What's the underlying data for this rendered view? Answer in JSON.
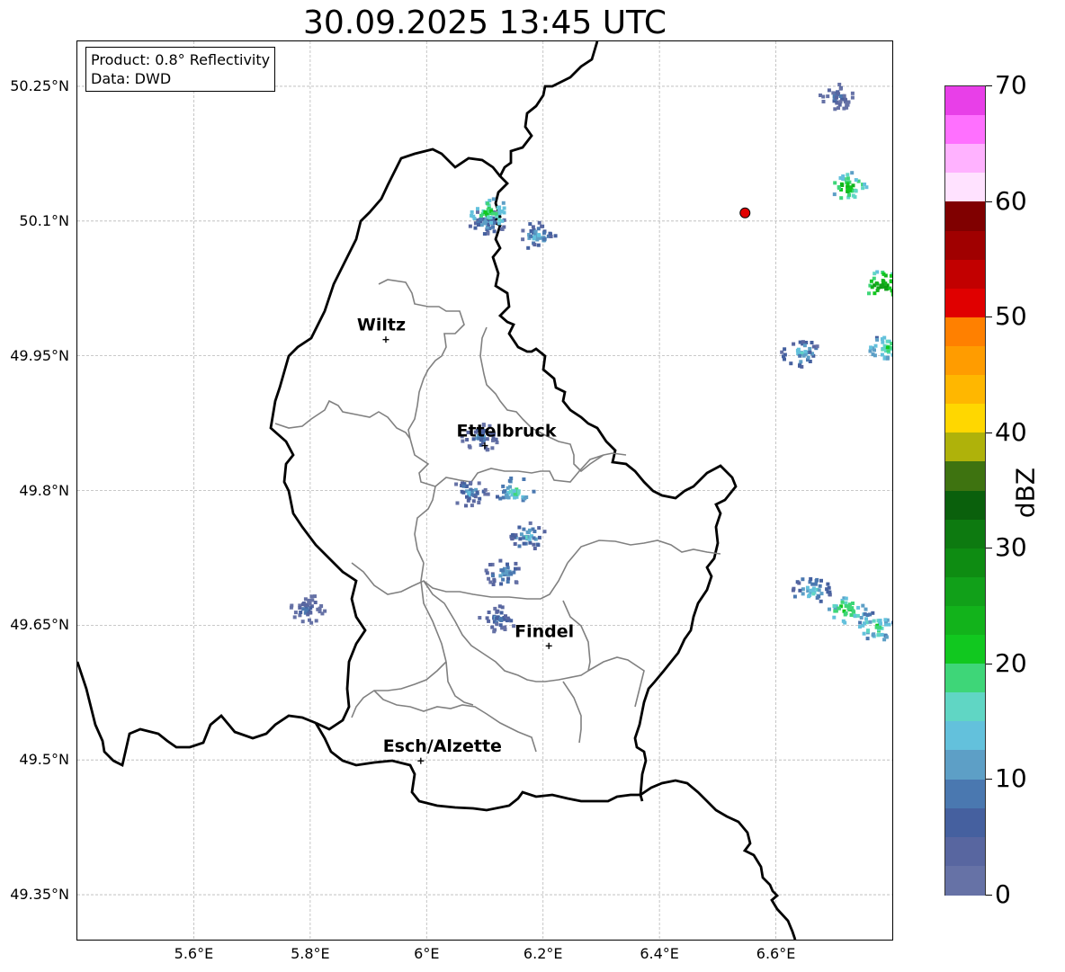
{
  "title": "30.09.2025 13:45 UTC",
  "info": {
    "product": "Product: 0.8° Reflectivity",
    "data": "Data: DWD"
  },
  "y_ticks": [
    {
      "value": 50.25,
      "label": "50.25°N"
    },
    {
      "value": 50.1,
      "label": "50.1°N"
    },
    {
      "value": 49.95,
      "label": "49.95°N"
    },
    {
      "value": 49.8,
      "label": "49.8°N"
    },
    {
      "value": 49.65,
      "label": "49.65°N"
    },
    {
      "value": 49.5,
      "label": "49.5°N"
    },
    {
      "value": 49.35,
      "label": "49.35°N"
    }
  ],
  "x_ticks": [
    {
      "value": 5.6,
      "label": "5.6°E"
    },
    {
      "value": 5.8,
      "label": "5.8°E"
    },
    {
      "value": 6.0,
      "label": "6°E"
    },
    {
      "value": 6.2,
      "label": "6.2°E"
    },
    {
      "value": 6.4,
      "label": "6.4°E"
    },
    {
      "value": 6.6,
      "label": "6.6°E"
    }
  ],
  "extent": {
    "lon": [
      5.4,
      6.8
    ],
    "lat": [
      49.3,
      50.3
    ]
  },
  "cities": [
    {
      "name": "Wiltz",
      "lon": 5.93,
      "lat": 49.968
    },
    {
      "name": "Ettelbruck",
      "lon": 6.1,
      "lat": 49.85
    },
    {
      "name": "Findel",
      "lon": 6.21,
      "lat": 49.627
    },
    {
      "name": "Esch/Alzette",
      "lon": 5.99,
      "lat": 49.499
    }
  ],
  "radar_site": {
    "lon": 6.547,
    "lat": 50.109,
    "color": "#e00000"
  },
  "colorbar": {
    "unit": "dBZ",
    "min": 0,
    "max": 70,
    "tick_labels": [
      "0",
      "10",
      "20",
      "30",
      "40",
      "50",
      "60",
      "70"
    ],
    "colors": [
      "#6672a6",
      "#5866a0",
      "#45609f",
      "#4a78b0",
      "#5d9fc6",
      "#63c1dc",
      "#60d6c4",
      "#3ed678",
      "#11c81f",
      "#12b31b",
      "#11a019",
      "#0e8c12",
      "#0d7a10",
      "#0a600c",
      "#3e7310",
      "#afb20a",
      "#ffd700",
      "#ffb700",
      "#ff9c00",
      "#ff8000",
      "#e00000",
      "#c20000",
      "#a00000",
      "#800000",
      "#ffe2ff",
      "#ffb2ff",
      "#ff70ff",
      "#e83fe8"
    ]
  },
  "radar_cells": [
    {
      "lon": 6.1,
      "lat": 50.1,
      "dbz": 12
    },
    {
      "lon": 6.105,
      "lat": 50.112,
      "dbz": 22
    },
    {
      "lon": 6.19,
      "lat": 50.085,
      "dbz": 14
    },
    {
      "lon": 6.72,
      "lat": 50.14,
      "dbz": 24
    },
    {
      "lon": 6.78,
      "lat": 50.03,
      "dbz": 28
    },
    {
      "lon": 6.79,
      "lat": 49.96,
      "dbz": 20
    },
    {
      "lon": 6.64,
      "lat": 49.955,
      "dbz": 15
    },
    {
      "lon": 6.09,
      "lat": 49.86,
      "dbz": 10
    },
    {
      "lon": 6.07,
      "lat": 49.8,
      "dbz": 12
    },
    {
      "lon": 6.15,
      "lat": 49.8,
      "dbz": 18
    },
    {
      "lon": 6.17,
      "lat": 49.75,
      "dbz": 14
    },
    {
      "lon": 6.13,
      "lat": 49.71,
      "dbz": 12
    },
    {
      "lon": 6.12,
      "lat": 49.66,
      "dbz": 10
    },
    {
      "lon": 5.79,
      "lat": 49.67,
      "dbz": 8
    },
    {
      "lon": 6.66,
      "lat": 49.69,
      "dbz": 16
    },
    {
      "lon": 6.72,
      "lat": 49.67,
      "dbz": 22
    },
    {
      "lon": 6.77,
      "lat": 49.65,
      "dbz": 20
    },
    {
      "lon": 6.7,
      "lat": 50.24,
      "dbz": 8
    }
  ]
}
